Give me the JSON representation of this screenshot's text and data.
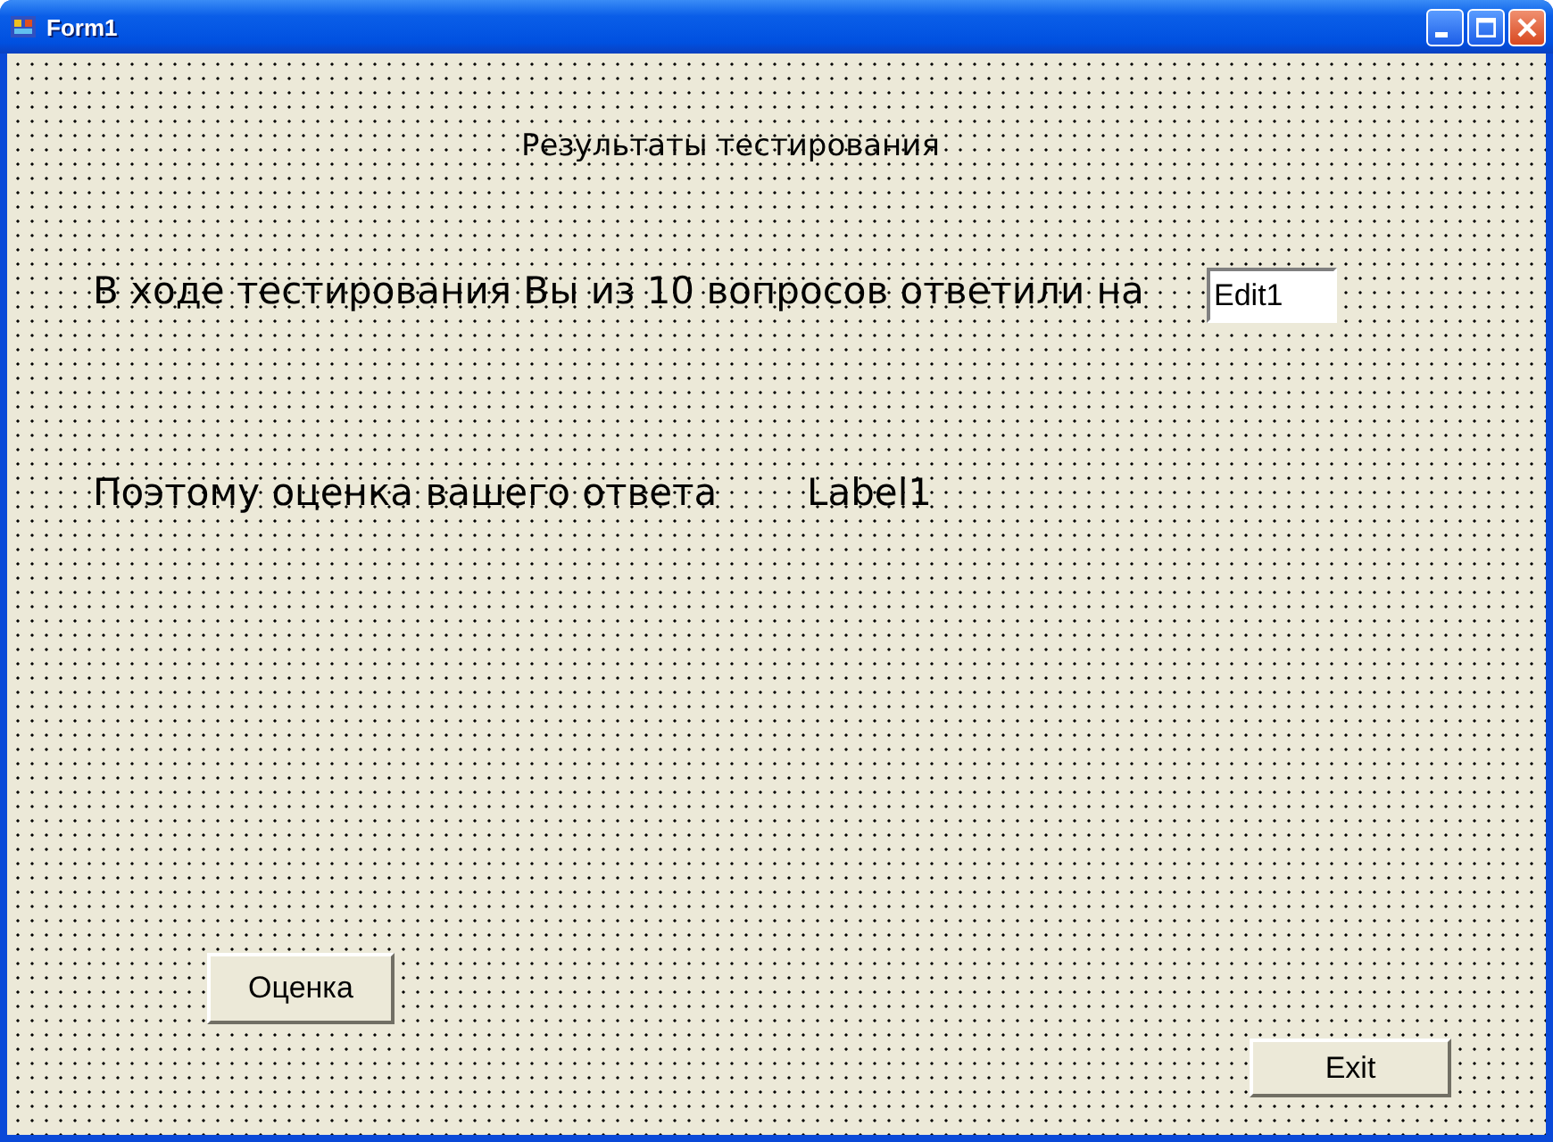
{
  "window": {
    "title": "Form1"
  },
  "form": {
    "heading": "Результаты тестирования",
    "question_label": "В ходе тестирования Вы из 10 вопросов ответили на",
    "answers_field": {
      "value": "Edit1"
    },
    "grade_caption": "Поэтому оценка вашего ответа",
    "grade_label": "Label1",
    "buttons": [
      {
        "kind": "grade",
        "label": "Оценка"
      },
      {
        "kind": "exit",
        "label": "Exit"
      }
    ]
  }
}
